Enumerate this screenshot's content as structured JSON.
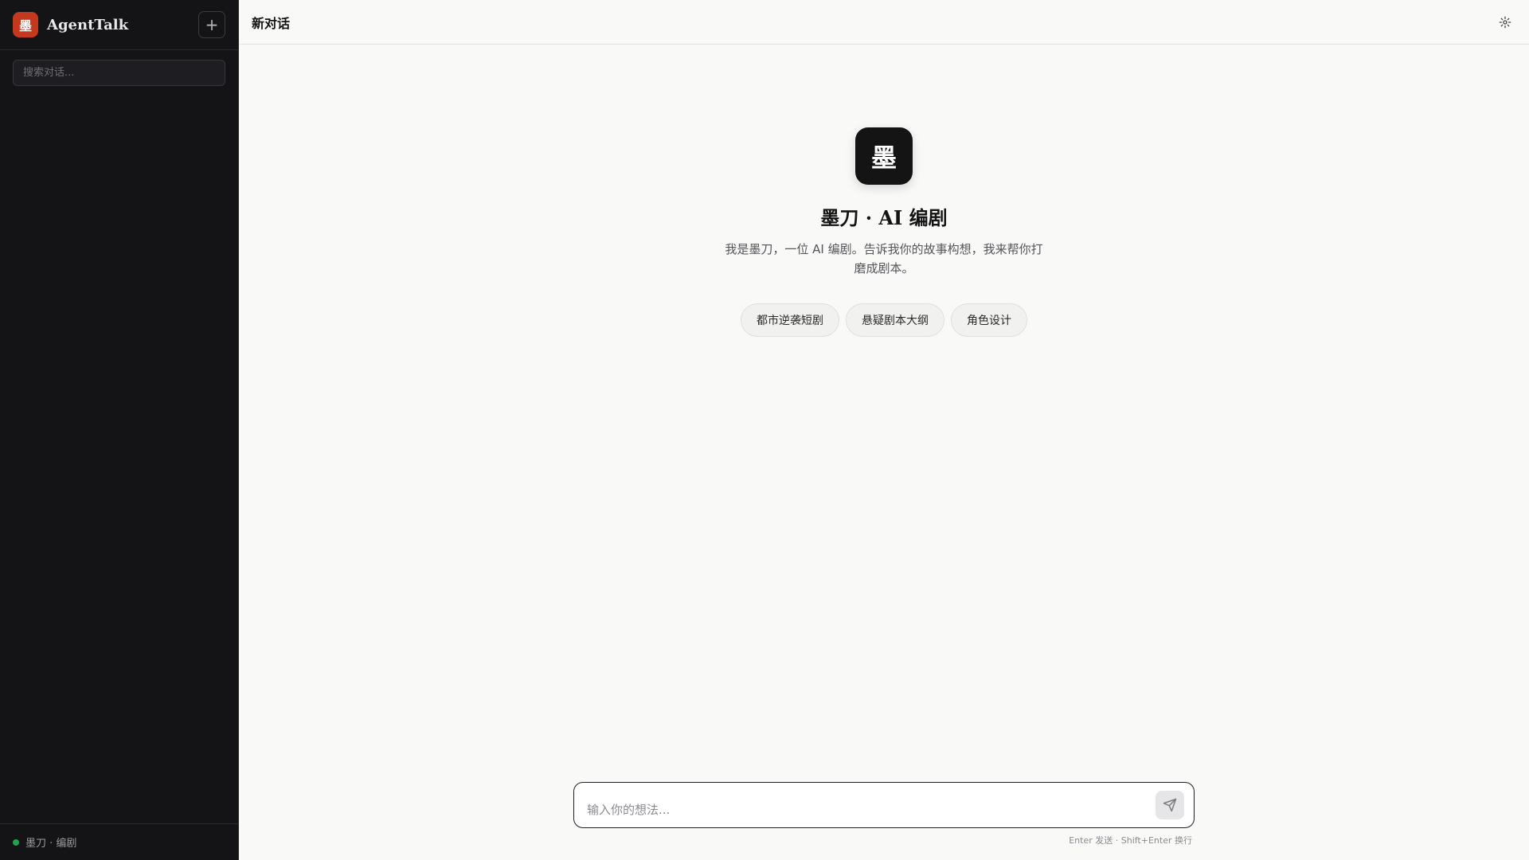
{
  "sidebar": {
    "logo_char": "墨",
    "brand": "AgentTalk",
    "new_button": "+",
    "search_placeholder": "搜索对话...",
    "footer_label": "墨刀 · 编剧",
    "status_color": "#22a352"
  },
  "header": {
    "title": "新对话",
    "settings_icon": "gear-icon"
  },
  "welcome": {
    "logo_char": "墨",
    "title": "墨刀 · AI 编剧",
    "description": "我是墨刀，一位 AI 编剧。告诉我你的故事构想，我来帮你打磨成剧本。",
    "suggestions": [
      "都市逆袭短剧",
      "悬疑剧本大纲",
      "角色设计"
    ]
  },
  "composer": {
    "placeholder": "输入你的想法...",
    "send_icon": "send-icon",
    "hint": "Enter 发送 · Shift+Enter 换行"
  },
  "colors": {
    "accent": "#c4381f",
    "sidebar_bg": "#141416",
    "main_bg": "#f9f9f8"
  }
}
